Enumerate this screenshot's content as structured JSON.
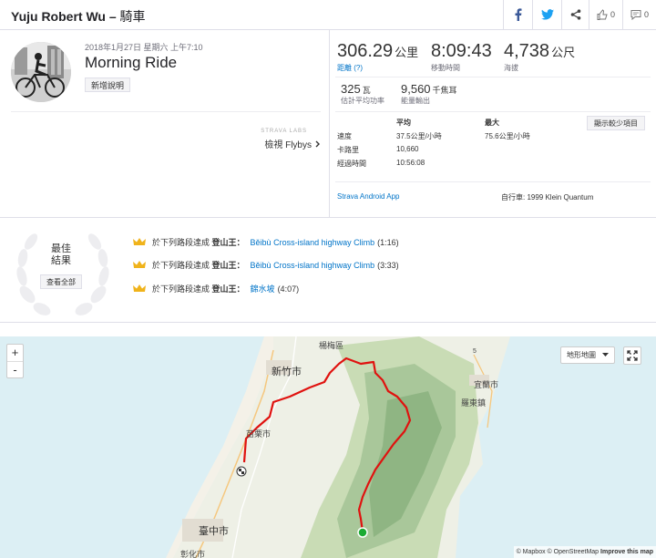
{
  "header": {
    "athlete": "Yuju Robert Wu",
    "separator": " – ",
    "sport": "騎車",
    "likes_count": "0",
    "comments_count": "0"
  },
  "activity": {
    "date": "2018年1月27日 星期六 上午7:10",
    "name": "Morning Ride",
    "add_description": "新增說明",
    "labs_note": "STRAVA LABS",
    "flybys": "檢視 Flybys"
  },
  "stats": {
    "distance": {
      "value": "306.29",
      "unit": "公里",
      "label": "距離 (?)"
    },
    "moving_time": {
      "value": "8:09:43",
      "label": "移動時間"
    },
    "elevation": {
      "value": "4,738",
      "unit": "公尺",
      "label": "海拔"
    },
    "power": {
      "value": "325",
      "unit": "瓦",
      "label": "估計平均功率"
    },
    "energy": {
      "value": "9,560",
      "unit": "千焦耳",
      "label": "能量輸出"
    },
    "show_less": "顯示較少項目",
    "table": {
      "headers": [
        "",
        "平均",
        "最大"
      ],
      "rows": [
        [
          "速度",
          "37.5公里/小時",
          "75.6公里/小時"
        ],
        [
          "卡路里",
          "10,660",
          ""
        ],
        [
          "經過時間",
          "10:56:08",
          ""
        ]
      ]
    },
    "device": "Strava Android App",
    "bike": "自行車: 1999 Klein Quantum"
  },
  "achievements": {
    "title_line1": "最佳",
    "title_line2": "結果",
    "view_all": "查看全部",
    "prefix": "於下列路段達成",
    "achievement": "登山王：",
    "items": [
      {
        "segment": "Běibù Cross-island highway Climb",
        "time": "(1:16)"
      },
      {
        "segment": "Běibù Cross-island highway Climb",
        "time": "(3:33)"
      },
      {
        "segment": "錦水坡",
        "time": "(4:07)"
      }
    ]
  },
  "map": {
    "zoom_in": "+",
    "zoom_out": "-",
    "map_type": "地形地圖",
    "attribution_mapbox": "© Mapbox",
    "attribution_osm": "© OpenStreetMap",
    "improve": "Improve this map",
    "places": {
      "hsinchu": "新竹市",
      "taichung": "臺中市",
      "yilan": "宜蘭市",
      "luodong": "羅東鎮",
      "miaoli": "苗栗市",
      "hsinchu_north": "楊梅區",
      "changhua": "彰化市",
      "road_5": "5"
    }
  },
  "colors": {
    "brand": "#fc4c02",
    "link": "#0074c8",
    "route": "#e0120f",
    "facebook": "#3b5998",
    "twitter": "#1da1f2",
    "crown": "#f0b31b",
    "end_marker": "#1cab34"
  },
  "icons": [
    "facebook-icon",
    "twitter-icon",
    "share-icon",
    "kudos-icon",
    "comment-icon",
    "crown-icon",
    "chevron-right-icon",
    "fullscreen-icon",
    "caret-down-icon"
  ]
}
